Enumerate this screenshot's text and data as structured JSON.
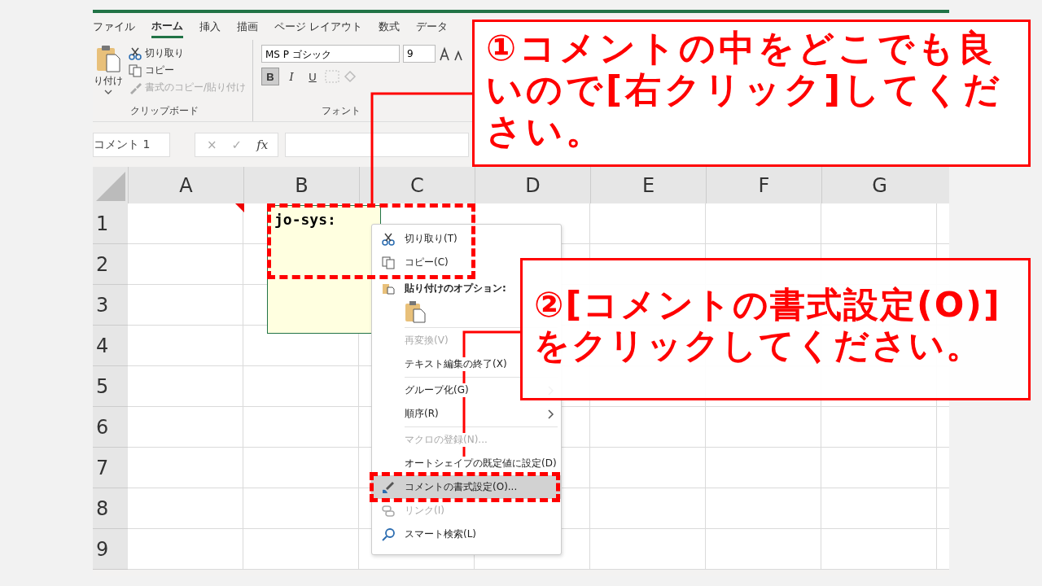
{
  "ribbon_tabs": [
    {
      "label": "ファイル",
      "selected": false
    },
    {
      "label": "ホーム",
      "selected": true
    },
    {
      "label": "挿入",
      "selected": false
    },
    {
      "label": "描画",
      "selected": false
    },
    {
      "label": "ページ レイアウト",
      "selected": false
    },
    {
      "label": "数式",
      "selected": false
    },
    {
      "label": "データ",
      "selected": false
    }
  ],
  "clipboard": {
    "paste_label": "り付け",
    "cut": "切り取り",
    "copy": "コピー",
    "format_painter": "書式のコピー/貼り付け",
    "group_label": "クリップボード"
  },
  "font": {
    "font_name": "MS P ゴシック",
    "font_size": "9",
    "format_buttons": [
      {
        "label": "B",
        "selected": true
      },
      {
        "label": "I",
        "selected": false
      },
      {
        "label": "U",
        "selected": false
      }
    ],
    "group_label": "フォント"
  },
  "formula_bar": {
    "name_box": "コメント 1",
    "cancel": "×",
    "enter": "✓",
    "function": "fx"
  },
  "sheet": {
    "columns": [
      "A",
      "B",
      "C",
      "D",
      "E",
      "F",
      "G"
    ],
    "rows": [
      "1",
      "2",
      "3",
      "4",
      "5",
      "6",
      "7",
      "8",
      "9"
    ],
    "comment": "jo-sys:"
  },
  "context_menu": [
    {
      "kind": "item",
      "label": "切り取り(T)",
      "disabled": false,
      "selected": false,
      "submenu": false
    },
    {
      "kind": "item",
      "label": "コピー(C)",
      "disabled": false,
      "selected": false,
      "submenu": false
    },
    {
      "kind": "header",
      "label": "貼り付けのオプション:"
    },
    {
      "kind": "paste"
    },
    {
      "kind": "separator"
    },
    {
      "kind": "item",
      "label": "再変換(V)",
      "disabled": true,
      "selected": false,
      "submenu": false
    },
    {
      "kind": "item",
      "label": "テキスト編集の終了(X)",
      "disabled": false,
      "selected": false,
      "submenu": false
    },
    {
      "kind": "separator"
    },
    {
      "kind": "item",
      "label": "グループ化(G)",
      "disabled": false,
      "selected": false,
      "submenu": true
    },
    {
      "kind": "item",
      "label": "順序(R)",
      "disabled": false,
      "selected": false,
      "submenu": true
    },
    {
      "kind": "separator"
    },
    {
      "kind": "item",
      "label": "マクロの登録(N)...",
      "disabled": true,
      "selected": false,
      "submenu": false
    },
    {
      "kind": "item",
      "label": "オートシェイプの既定値に設定(D)",
      "disabled": false,
      "selected": false,
      "submenu": false
    },
    {
      "kind": "item",
      "label": "コメントの書式設定(O)...",
      "disabled": false,
      "selected": true,
      "submenu": false
    },
    {
      "kind": "item",
      "label": "リンク(I)",
      "disabled": true,
      "selected": false,
      "submenu": false
    },
    {
      "kind": "item",
      "label": "スマート検索(L)",
      "disabled": false,
      "selected": false,
      "submenu": false
    }
  ],
  "callouts": [
    {
      "text": "①コメントの中をどこでも良いので[右クリック]してください。"
    },
    {
      "text": "②[コメントの書式設定(O)]をクリックしてください。"
    }
  ]
}
